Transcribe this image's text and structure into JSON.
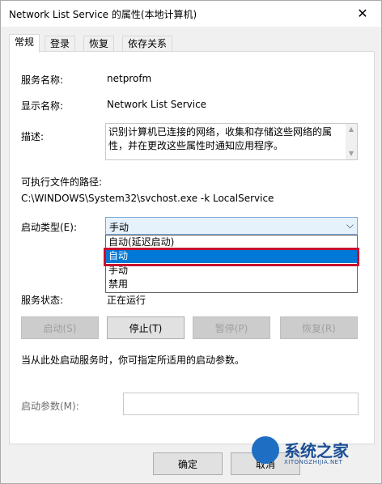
{
  "window": {
    "title": "Network List Service 的属性(本地计算机)",
    "close_glyph": "✕"
  },
  "tabs": [
    {
      "label": "常规",
      "active": true
    },
    {
      "label": "登录",
      "active": false
    },
    {
      "label": "恢复",
      "active": false
    },
    {
      "label": "依存关系",
      "active": false
    }
  ],
  "general": {
    "service_name_label": "服务名称:",
    "service_name_value": "netprofm",
    "display_name_label": "显示名称:",
    "display_name_value": "Network List Service",
    "description_label": "描述:",
    "description_value": "识别计算机已连接的网络，收集和存储这些网络的属性，并在更改这些属性时通知应用程序。",
    "exe_path_label": "可执行文件的路径:",
    "exe_path_value": "C:\\WINDOWS\\System32\\svchost.exe -k LocalService",
    "startup_type_label": "启动类型(E):",
    "startup_type_value": "手动",
    "startup_options": [
      "自动(延迟启动)",
      "自动",
      "手动",
      "禁用"
    ],
    "startup_selected": "自动",
    "status_label": "服务状态:",
    "status_value": "正在运行",
    "start_button": "启动(S)",
    "stop_button": "停止(T)",
    "pause_button": "暂停(P)",
    "resume_button": "恢复(R)",
    "hint_text": "当从此处启动服务时，你可指定所适用的启动参数。",
    "params_label": "启动参数(M):",
    "params_value": ""
  },
  "footer": {
    "ok_button": "确定",
    "cancel_button": "取消"
  },
  "watermark": {
    "text": "系统之家",
    "sub": "XITONGZHIJIA.NET"
  },
  "colors": {
    "accent": "#0078d7",
    "highlight_box": "#c8102e"
  }
}
